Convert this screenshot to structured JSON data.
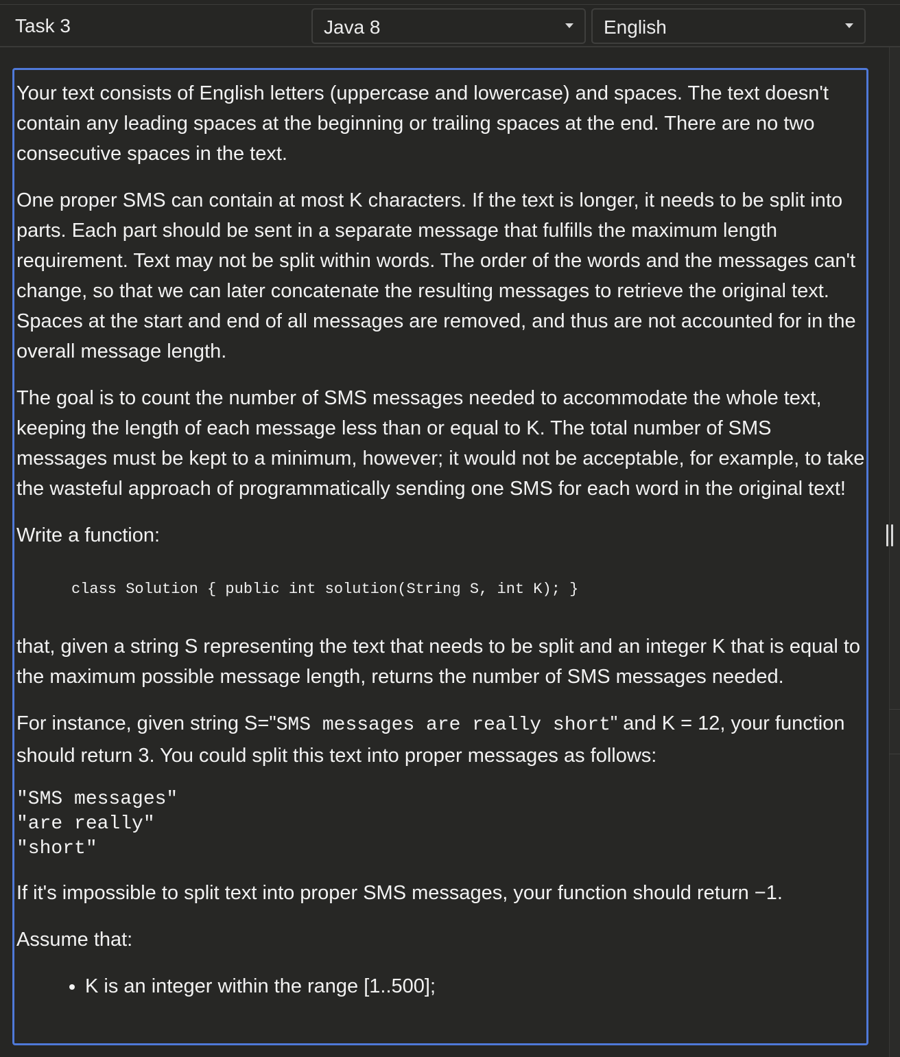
{
  "header": {
    "task_title": "Task 3",
    "programming_language": "Java 8",
    "human_language": "English"
  },
  "icons": {
    "dropdown": "chevron-down-icon",
    "resize": "drag-handle-icon"
  },
  "colors": {
    "background": "#262624",
    "focus_border": "#4f79d8",
    "text": "#f2f2f2"
  },
  "description": {
    "p1": "Your text consists of English letters (uppercase and lowercase) and spaces. The text doesn't contain any leading spaces at the beginning or trailing spaces at the end. There are no two consecutive spaces in the text.",
    "p2": "One proper SMS can contain at most K characters. If the text is longer, it needs to be split into parts. Each part should be sent in a separate message that fulfills the maximum length requirement. Text may not be split within words. The order of the words and the messages can't change, so that we can later concatenate the resulting messages to retrieve the original text. Spaces at the start and end of all messages are removed, and thus are not accounted for in the overall message length.",
    "p3": "The goal is to count the number of SMS messages needed to accommodate the whole text, keeping the length of each message less than or equal to K. The total number of SMS messages must be kept to a minimum, however; it would not be acceptable, for example, to take the wasteful approach of programmatically sending one SMS for each word in the original text!",
    "p4": "Write a function:",
    "signature": "class Solution { public int solution(String S, int K); }",
    "p5": "that, given a string S representing the text that needs to be split and an integer K that is equal to the maximum possible message length, returns the number of SMS messages needed.",
    "example_prefix": "For instance, given string S=\"",
    "example_string": "SMS messages are really short",
    "example_mid": "\" and K = 12, your function should return 3. You could split this text into proper messages as follows:",
    "split_lines": [
      "\"SMS messages\"",
      "\"are really\"",
      "\"short\""
    ],
    "p6": "If it's impossible to split text into proper SMS messages, your function should return −1.",
    "p7": "Assume that:",
    "assumptions": [
      "K is an integer within the range [1..500];"
    ]
  }
}
